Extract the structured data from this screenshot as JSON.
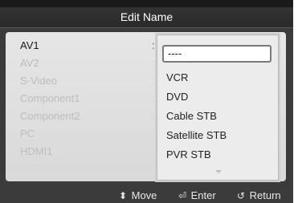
{
  "dialog": {
    "title": "Edit Name"
  },
  "sources": [
    {
      "name": "AV1",
      "separator": ":"
    },
    {
      "name": "AV2",
      "separator": ":"
    },
    {
      "name": "S-Video",
      "separator": ":"
    },
    {
      "name": "Component1",
      "separator": ":"
    },
    {
      "name": "Component2",
      "separator": ":"
    },
    {
      "name": "PC",
      "separator": ":"
    },
    {
      "name": "HDMI1",
      "separator": ":"
    }
  ],
  "dropdown": {
    "current_value": "----",
    "options": [
      "VCR",
      "DVD",
      "Cable STB",
      "Satellite STB",
      "PVR STB"
    ]
  },
  "footer": {
    "move": {
      "icon": "updown-arrows-icon",
      "glyph": "⬍",
      "label": "Move"
    },
    "enter": {
      "icon": "enter-icon",
      "glyph": "⏎",
      "label": "Enter"
    },
    "return": {
      "icon": "return-arrow-icon",
      "glyph": "↺",
      "label": "Return"
    }
  }
}
